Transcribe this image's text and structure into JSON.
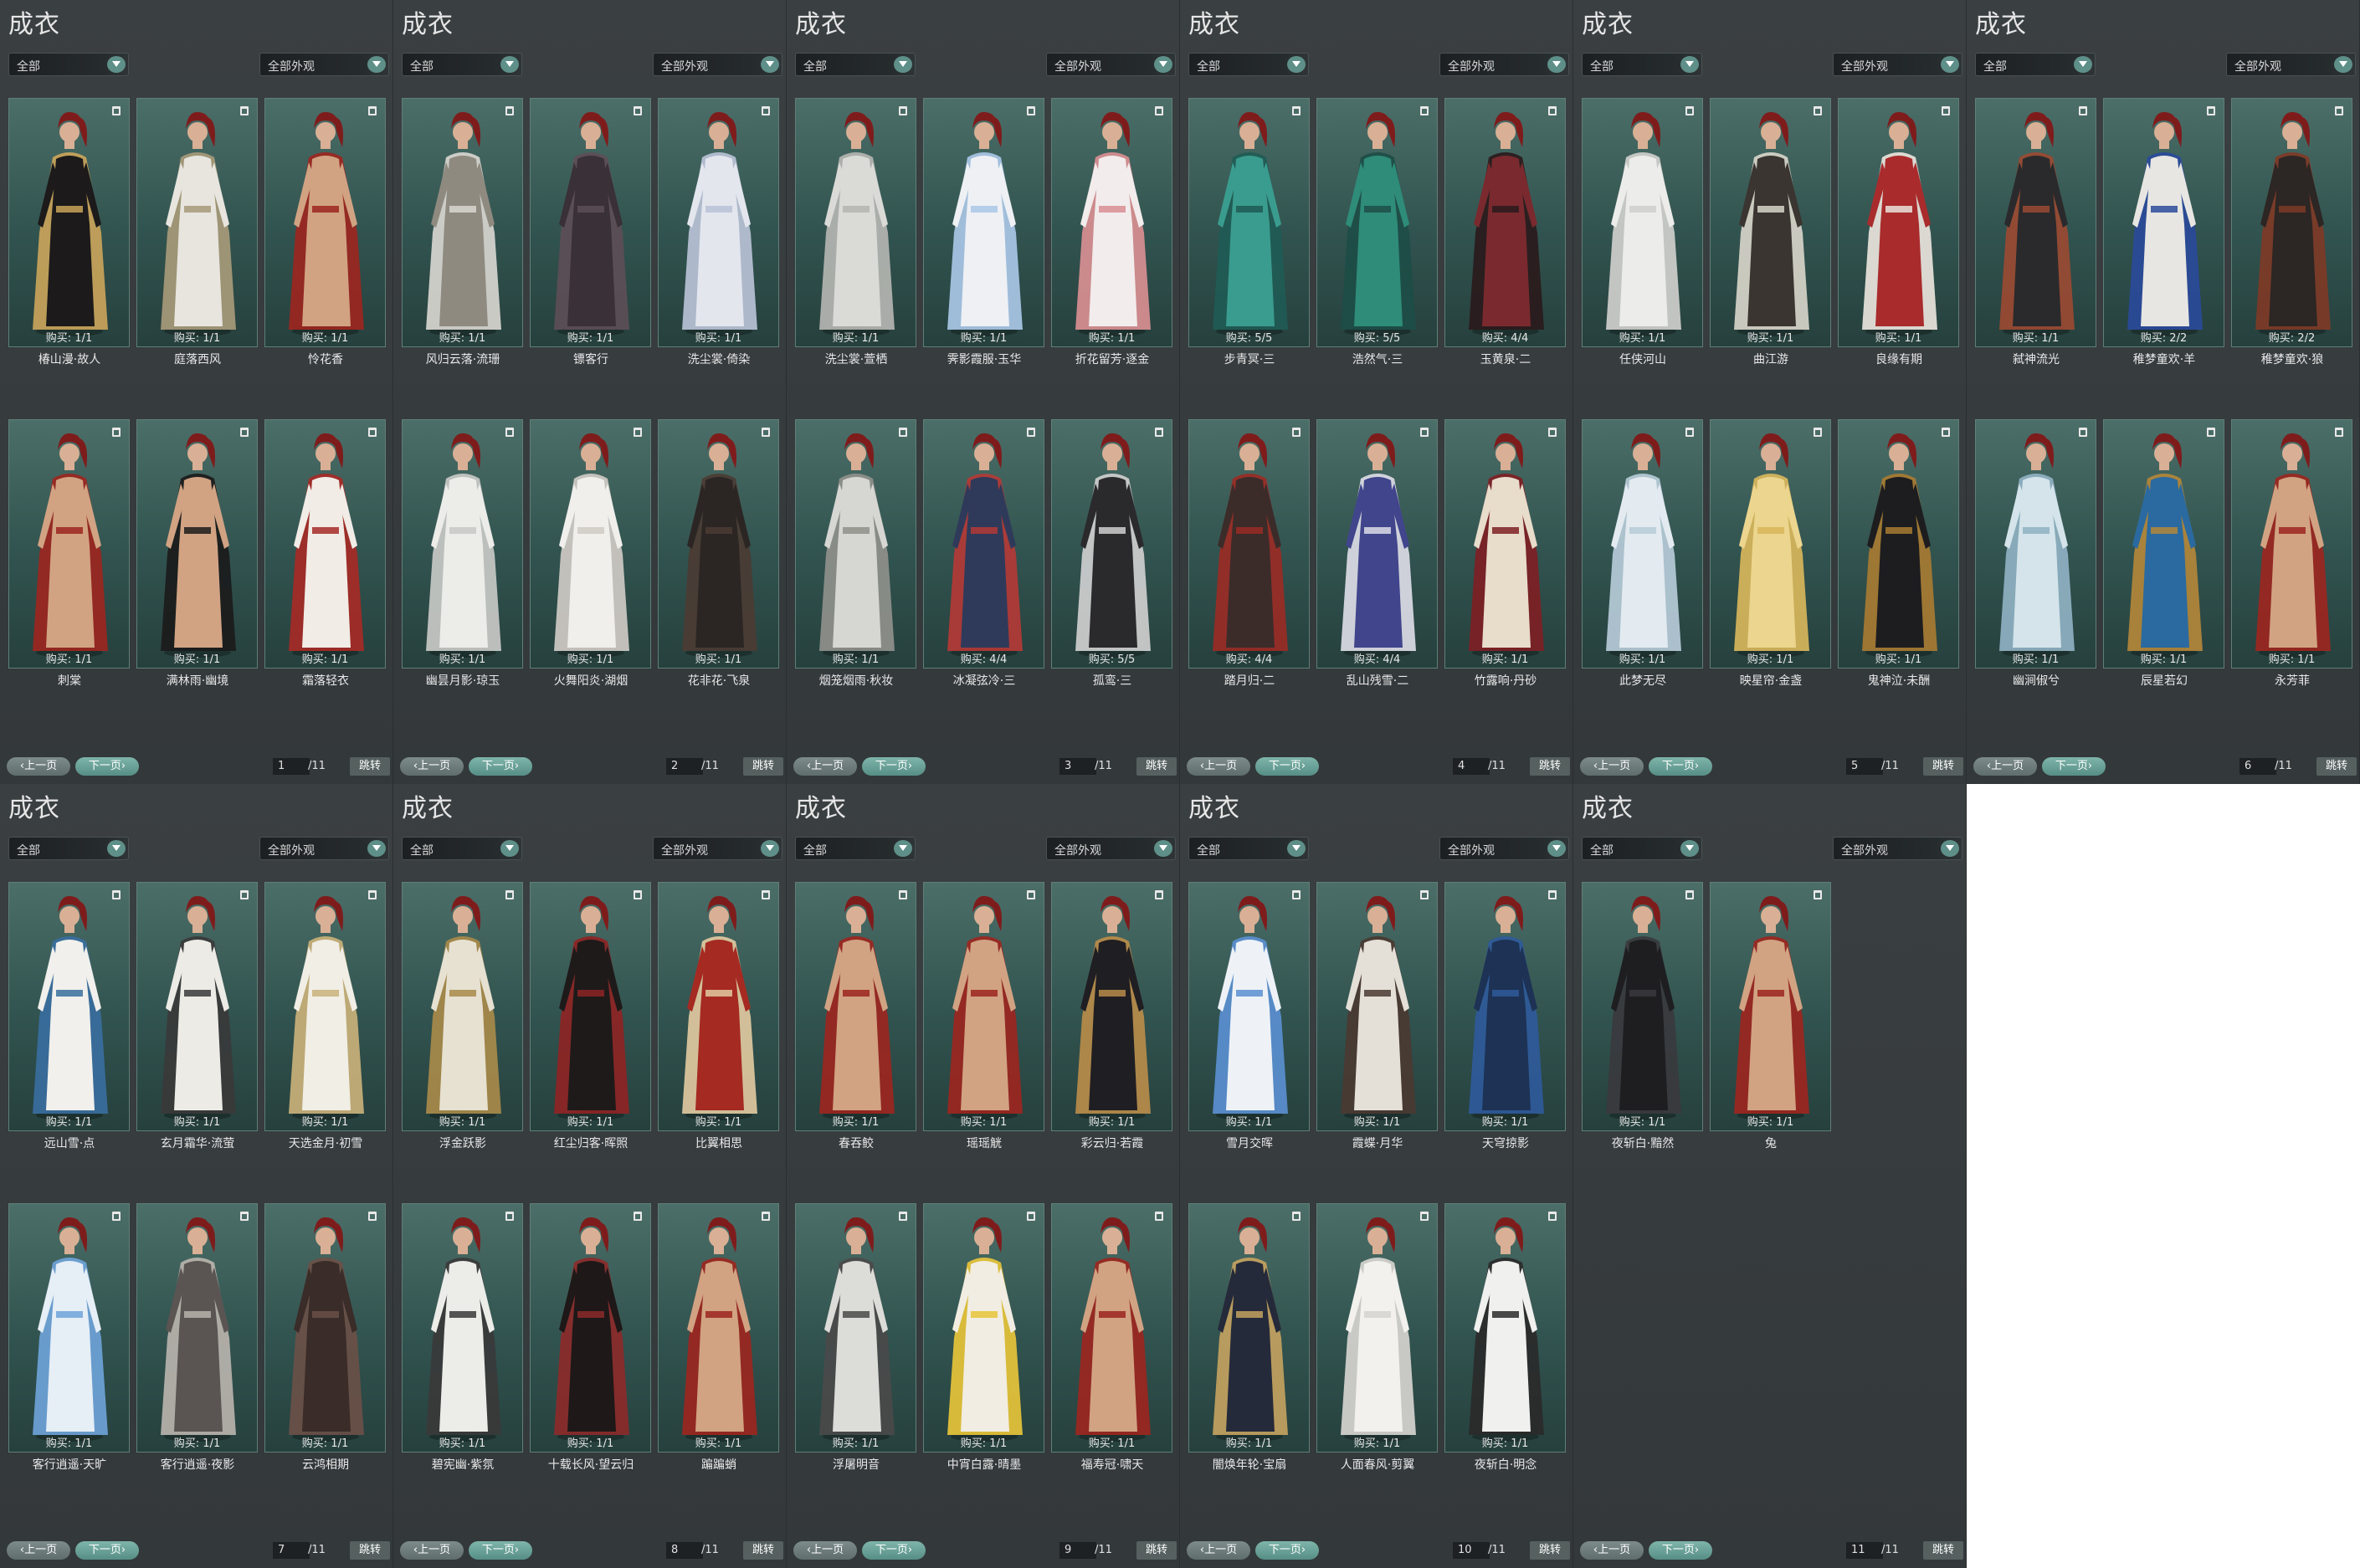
{
  "labels": {
    "title": "成衣",
    "filter_left": "全部",
    "filter_right": "全部外观",
    "prev": "上一页",
    "next": "下一页",
    "jump": "跳转"
  },
  "pages": [
    {
      "page": "1",
      "total": "/11",
      "items": [
        {
          "name": "椿山漫·故人",
          "buy": "购买: 1/1",
          "colors": [
            "#1c1a1a",
            "#c9a45a"
          ]
        },
        {
          "name": "庭落西风",
          "buy": "购买: 1/1",
          "colors": [
            "#e7e5de",
            "#a79a7a"
          ]
        },
        {
          "name": "怜花香",
          "buy": "购买: 1/1",
          "colors": [
            "#d1a383",
            "#9c2620"
          ]
        },
        {
          "name": "刺棠",
          "buy": "购买: 1/1",
          "colors": [
            "#d1a383",
            "#9c2620"
          ]
        },
        {
          "name": "满林雨·幽境",
          "buy": "购买: 1/1",
          "colors": [
            "#d1a383",
            "#1b1b1b"
          ]
        },
        {
          "name": "霜落轻衣",
          "buy": "购买: 1/1",
          "colors": [
            "#f1ece6",
            "#a62a26"
          ]
        }
      ]
    },
    {
      "page": "2",
      "total": "/11",
      "items": [
        {
          "name": "风归云落·流珊",
          "buy": "购买: 1/1",
          "colors": [
            "#8f8a80",
            "#d8d6d0"
          ]
        },
        {
          "name": "镖客行",
          "buy": "购买: 1/1",
          "colors": [
            "#3a3037",
            "#5d4e57"
          ]
        },
        {
          "name": "洗尘裳·倚染",
          "buy": "购买: 1/1",
          "colors": [
            "#e4e6ee",
            "#b9c2d6"
          ]
        },
        {
          "name": "幽昙月影·琼玉",
          "buy": "购买: 1/1",
          "colors": [
            "#ecece9",
            "#c8c9c6"
          ]
        },
        {
          "name": "火舞阳炎·湖烟",
          "buy": "购买: 1/1",
          "colors": [
            "#f0efec",
            "#cfcac4"
          ]
        },
        {
          "name": "花非花·飞泉",
          "buy": "购买: 1/1",
          "colors": [
            "#2b2624",
            "#4b3c34"
          ]
        }
      ]
    },
    {
      "page": "3",
      "total": "/11",
      "items": [
        {
          "name": "洗尘裳·萱栖",
          "buy": "购买: 1/1",
          "colors": [
            "#dadad7",
            "#b4b5b1"
          ]
        },
        {
          "name": "霁影霞服·玉华",
          "buy": "购买: 1/1",
          "colors": [
            "#eef0f4",
            "#a9c7e6"
          ]
        },
        {
          "name": "折花留芳·逐金",
          "buy": "购买: 1/1",
          "colors": [
            "#f2ecec",
            "#d98f93"
          ]
        },
        {
          "name": "烟笼烟雨·秋妆",
          "buy": "购买: 1/1",
          "colors": [
            "#d6d6d2",
            "#8f908b"
          ]
        },
        {
          "name": "冰凝弦冷·三",
          "buy": "购买: 4/4",
          "colors": [
            "#2f3a5a",
            "#b33a36"
          ]
        },
        {
          "name": "孤鸾·三",
          "buy": "购买: 5/5",
          "colors": [
            "#2a2a2c",
            "#cfcfcf"
          ]
        }
      ]
    },
    {
      "page": "4",
      "total": "/11",
      "items": [
        {
          "name": "步青冥·三",
          "buy": "购买: 5/5",
          "colors": [
            "#3a9c8e",
            "#1f5b55"
          ]
        },
        {
          "name": "浩然气·三",
          "buy": "购买: 5/5",
          "colors": [
            "#2e8c79",
            "#1d4d46"
          ]
        },
        {
          "name": "玉黄泉·二",
          "buy": "购买: 4/4",
          "colors": [
            "#7a2a2e",
            "#2a1a1c"
          ]
        },
        {
          "name": "踏月归·二",
          "buy": "购买: 4/4",
          "colors": [
            "#3b2c2a",
            "#9a2b25"
          ]
        },
        {
          "name": "乱山残雪·二",
          "buy": "购买: 4/4",
          "colors": [
            "#40458c",
            "#dcdce6"
          ]
        },
        {
          "name": "竹露响·丹砂",
          "buy": "购买: 1/1",
          "colors": [
            "#e8dccb",
            "#7e2024"
          ]
        }
      ]
    },
    {
      "page": "5",
      "total": "/11",
      "items": [
        {
          "name": "任侠河山",
          "buy": "购买: 1/1",
          "colors": [
            "#ececea",
            "#cfcfcc"
          ]
        },
        {
          "name": "曲江游",
          "buy": "购买: 1/1",
          "colors": [
            "#3a3530",
            "#d7d4c9"
          ]
        },
        {
          "name": "良缘有期",
          "buy": "购买: 1/1",
          "colors": [
            "#a92b2c",
            "#e9e4dc"
          ]
        },
        {
          "name": "此梦无尽",
          "buy": "购买: 1/1",
          "colors": [
            "#e3eaf0",
            "#b6cbd8"
          ]
        },
        {
          "name": "映星帘·金盏",
          "buy": "购买: 1/1",
          "colors": [
            "#ecd58e",
            "#d8b65b"
          ]
        },
        {
          "name": "鬼神泣·未酬",
          "buy": "购买: 1/1",
          "colors": [
            "#1d1d1f",
            "#a77b32"
          ]
        }
      ]
    },
    {
      "page": "6",
      "total": "/11",
      "items": [
        {
          "name": "弑神流光",
          "buy": "购买: 1/1",
          "colors": [
            "#2a2a2c",
            "#9a4a32"
          ]
        },
        {
          "name": "稚梦童欢·羊",
          "buy": "购买: 2/2",
          "colors": [
            "#e8e6e2",
            "#2a4a9a"
          ]
        },
        {
          "name": "稚梦童欢·狼",
          "buy": "购买: 2/2",
          "colors": [
            "#2c2624",
            "#7e3a26"
          ]
        },
        {
          "name": "幽涧俶兮",
          "buy": "购买: 1/1",
          "colors": [
            "#d4e4ea",
            "#8fb1c2"
          ]
        },
        {
          "name": "辰星若幻",
          "buy": "购买: 1/1",
          "colors": [
            "#2a6aa0",
            "#b3873a"
          ]
        },
        {
          "name": "永芳菲",
          "buy": "购买: 1/1",
          "colors": [
            "#d1a383",
            "#9c2620"
          ]
        }
      ]
    },
    {
      "page": "7",
      "total": "/11",
      "items": [
        {
          "name": "远山雪·点",
          "buy": "购买: 1/1",
          "colors": [
            "#f1f0ec",
            "#3a6e9e"
          ]
        },
        {
          "name": "玄月霜华·流萤",
          "buy": "购买: 1/1",
          "colors": [
            "#ecebe6",
            "#3a3a3a"
          ]
        },
        {
          "name": "天选金月·初雪",
          "buy": "购买: 1/1",
          "colors": [
            "#f1eee6",
            "#c9b17a"
          ]
        },
        {
          "name": "客行逍遥·天旷",
          "buy": "购买: 1/1",
          "colors": [
            "#e6eef6",
            "#6ea3d8"
          ]
        },
        {
          "name": "客行逍遥·夜影",
          "buy": "购买: 1/1",
          "colors": [
            "#5a5452",
            "#b8b3ad"
          ]
        },
        {
          "name": "云鸿相期",
          "buy": "购买: 1/1",
          "colors": [
            "#3a2c28",
            "#6a5048"
          ]
        }
      ]
    },
    {
      "page": "8",
      "total": "/11",
      "items": [
        {
          "name": "浮金跃影",
          "buy": "购买: 1/1",
          "colors": [
            "#e7e1d2",
            "#a88a4a"
          ]
        },
        {
          "name": "红尘归客·晖照",
          "buy": "购买: 1/1",
          "colors": [
            "#1e1a1a",
            "#8e2424"
          ]
        },
        {
          "name": "比翼相思",
          "buy": "购买: 1/1",
          "colors": [
            "#a52a22",
            "#e0c9a0"
          ]
        },
        {
          "name": "碧宪幽·紫氛",
          "buy": "购买: 1/1",
          "colors": [
            "#ecece8",
            "#3a3a3a"
          ]
        },
        {
          "name": "十载长风·望云归",
          "buy": "购买: 1/1",
          "colors": [
            "#1e1818",
            "#8c2a2a"
          ]
        },
        {
          "name": "蹁蹁蛸",
          "buy": "购买: 1/1",
          "colors": [
            "#d1a383",
            "#9c2620"
          ]
        }
      ]
    },
    {
      "page": "9",
      "total": "/11",
      "items": [
        {
          "name": "春吞鲛",
          "buy": "购买: 1/1",
          "colors": [
            "#d1a383",
            "#9c2620"
          ]
        },
        {
          "name": "瑶瑶觥",
          "buy": "购买: 1/1",
          "colors": [
            "#d1a383",
            "#9c2620"
          ]
        },
        {
          "name": "彩云归·若霞",
          "buy": "购买: 1/1",
          "colors": [
            "#1f1e22",
            "#b88c4a"
          ]
        },
        {
          "name": "浮屠明音",
          "buy": "购买: 1/1",
          "colors": [
            "#dcdcd8",
            "#4a4a4a"
          ]
        },
        {
          "name": "中宵白露·晴墨",
          "buy": "购买: 1/1",
          "colors": [
            "#f1ede2",
            "#e7c43a"
          ]
        },
        {
          "name": "福寿冠·啸天",
          "buy": "购买: 1/1",
          "colors": [
            "#d1a383",
            "#9c2620"
          ]
        }
      ]
    },
    {
      "page": "10",
      "total": "/11",
      "items": [
        {
          "name": "雪月交晖",
          "buy": "购买: 1/1",
          "colors": [
            "#eef2f6",
            "#5a8fd0"
          ]
        },
        {
          "name": "霞蝶·月华",
          "buy": "购买: 1/1",
          "colors": [
            "#e4e0d8",
            "#4a3a32"
          ]
        },
        {
          "name": "天穹掠影",
          "buy": "购买: 1/1",
          "colors": [
            "#1d3254",
            "#2f5a9a"
          ]
        },
        {
          "name": "闇焕年轮·宝扇",
          "buy": "购买: 1/1",
          "colors": [
            "#252a3a",
            "#c3a260"
          ]
        },
        {
          "name": "人面春风·剪翼",
          "buy": "购买: 1/1",
          "colors": [
            "#f2f1ee",
            "#d6d4cf"
          ]
        },
        {
          "name": "夜斩白·明念",
          "buy": "购买: 1/1",
          "colors": [
            "#f0f0ee",
            "#2a2a2a"
          ]
        }
      ]
    },
    {
      "page": "11",
      "total": "/11",
      "items": [
        {
          "name": "夜斩白·黯然",
          "buy": "购买: 1/1",
          "colors": [
            "#1e1e20",
            "#3a3a3e"
          ]
        },
        {
          "name": "兔",
          "buy": "购买: 1/1",
          "colors": [
            "#d1a383",
            "#9c2620"
          ]
        }
      ]
    }
  ]
}
